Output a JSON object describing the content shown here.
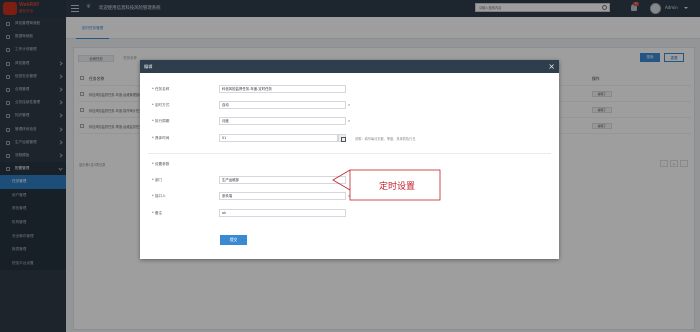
{
  "header": {
    "logo_name": "WebRAY",
    "logo_sub": "盛邦安全",
    "title": "欢迎使用信息科技风险管理系统",
    "search_placeholder": "请输入搜索内容",
    "notif_count": "1",
    "user": "Admin"
  },
  "sidebar": {
    "items": [
      {
        "label": "风险管理驾驶舱"
      },
      {
        "label": "数据驾驶舱"
      },
      {
        "label": "工作计划管理"
      },
      {
        "label": "风险管理"
      },
      {
        "label": "信息安全管理"
      },
      {
        "label": "合规管理"
      },
      {
        "label": "业务连续性管理"
      },
      {
        "label": "知识管理"
      },
      {
        "label": "管理体系检查"
      },
      {
        "label": "生产运维管理"
      },
      {
        "label": "流程模板"
      },
      {
        "label": "配置管理"
      }
    ],
    "subitems": [
      {
        "label": "任务管理"
      },
      {
        "label": "用户管理"
      },
      {
        "label": "角色管理"
      },
      {
        "label": "机构管理"
      },
      {
        "label": "安全事件管理"
      },
      {
        "label": "报表管理"
      },
      {
        "label": "短信平台设置"
      }
    ]
  },
  "main": {
    "tab": "定时任务管理",
    "select_all": "全局任务",
    "filter_chip": "任务名称",
    "search_btn": "搜索",
    "reset_btn": "重置",
    "col_name": "任务名称",
    "col_op": "操作",
    "rows": [
      {
        "name": "科信风险监督任务-年度-运维管理部任务",
        "op": "编辑了"
      },
      {
        "name": "科信风险监督任务-年度-操作审计任务",
        "op": "编辑了"
      },
      {
        "name": "科信风险监督任务-季度-运维监督任务",
        "op": "编辑了"
      }
    ],
    "footer": "显示第1至3项记录",
    "page": "1"
  },
  "modal": {
    "title": "编辑",
    "fields": {
      "task_name_label": "* 任务名称",
      "task_name_value": "科信风险监督任务-年度-定时任务",
      "timing_label": "* 定时方式",
      "timing_value": "自动",
      "cycle_label": "* 执行周期",
      "cycle_value": "月度",
      "exec_time_label": "* 具体时间",
      "exec_time_value": "01",
      "hint": "说明：填写每月天数、季度、具体的执行日",
      "section": "* 设置参数",
      "dept_label": "* 部门",
      "dept_value": "生产运维部",
      "assignee_label": "* 接口人",
      "assignee_value": "张玖瑞",
      "note_label": "* 备注",
      "note_value": "ok"
    },
    "submit": "提交"
  },
  "annotation": {
    "text": "定时设置",
    "color": "#c0202a"
  }
}
